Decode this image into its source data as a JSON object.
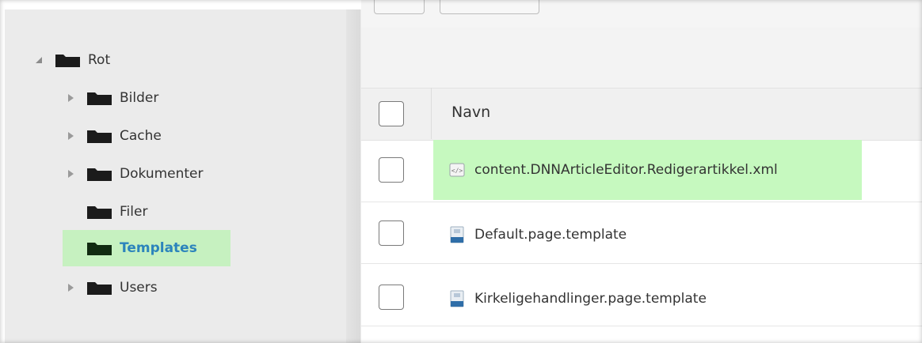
{
  "tree": {
    "root": {
      "label": "Rot",
      "icon": "folder-icon",
      "toggle": "collapse-triangle-icon"
    },
    "children": [
      {
        "label": "Bilder",
        "has_children": true
      },
      {
        "label": "Cache",
        "has_children": true
      },
      {
        "label": "Dokumenter",
        "has_children": true
      },
      {
        "label": "Filer",
        "has_children": false
      },
      {
        "label": "Templates",
        "has_children": false,
        "selected": true
      },
      {
        "label": "Users",
        "has_children": true
      }
    ]
  },
  "grid": {
    "header": {
      "name_label": "Navn"
    },
    "rows": [
      {
        "name": "content.DNNArticleEditor.Redigerartikkel.xml",
        "icon": "xml-file-icon",
        "highlighted": true
      },
      {
        "name": "Default.page.template",
        "icon": "template-file-icon",
        "highlighted": false
      },
      {
        "name": "Kirkeligehandlinger.page.template",
        "icon": "template-file-icon",
        "highlighted": false
      }
    ]
  },
  "colors": {
    "selection_green": "#c6f1c0",
    "selected_text": "#2c84bc",
    "sidebar_bg": "#ebebeb"
  }
}
